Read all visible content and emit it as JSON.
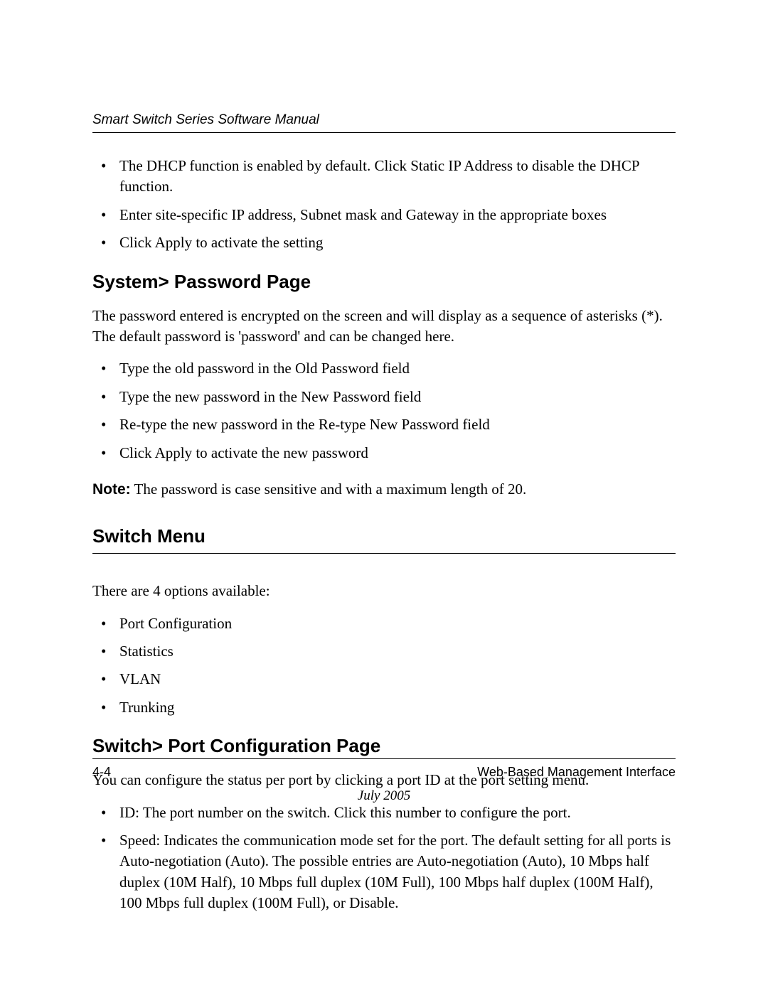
{
  "header": {
    "running_title": "Smart Switch Series Software Manual"
  },
  "intro_bullets": [
    "The DHCP function is enabled by default. Click Static IP Address to disable the DHCP function.",
    "Enter site-specific IP address, Subnet mask and Gateway in the appropriate boxes",
    "Click Apply to activate the setting"
  ],
  "section_password": {
    "heading": "System> Password Page",
    "intro": "The password entered is encrypted on the screen and will display as a sequence of asterisks (*). The default password is 'password' and can be changed here.",
    "bullets": [
      "Type the old password in the Old Password field",
      "Type the new password in the New Password field",
      "Re-type the new password in the Re-type New Password field",
      "Click Apply to activate the new password"
    ],
    "note_label": "Note:",
    "note_text": " The password is case sensitive and with a maximum length of 20."
  },
  "section_switch_menu": {
    "heading": "Switch Menu",
    "intro": "There are 4 options available:",
    "bullets": [
      "Port Configuration",
      "Statistics",
      "VLAN",
      "Trunking"
    ]
  },
  "section_port_config": {
    "heading": "Switch> Port Configuration Page",
    "intro": "You can configure the status per port by clicking a port ID at the port setting menu.",
    "bullets": [
      "ID: The port number on the switch. Click this number to configure the port.",
      "Speed: Indicates the communication mode set for the port. The default setting for all ports is Auto-negotiation (Auto). The possible entries are Auto-negotiation (Auto), 10 Mbps half duplex (10M Half), 10 Mbps full duplex (10M Full), 100 Mbps half duplex (100M Half), 100 Mbps full duplex (100M Full), or Disable."
    ]
  },
  "footer": {
    "page_number": "4-4",
    "section_title": "Web-Based Management Interface",
    "date": "July 2005"
  }
}
